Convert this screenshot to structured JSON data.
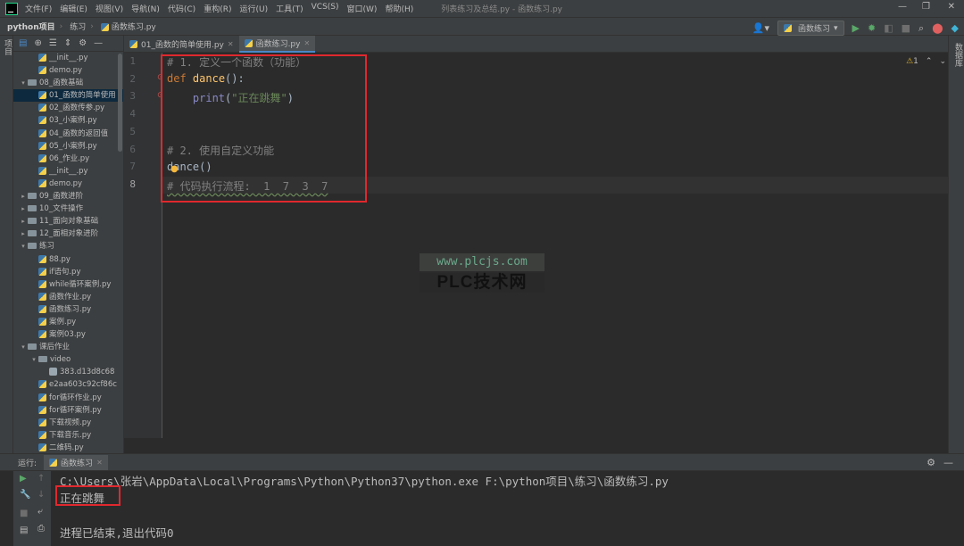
{
  "menubar": {
    "items": [
      "文件(F)",
      "编辑(E)",
      "视图(V)",
      "导航(N)",
      "代码(C)",
      "重构(R)",
      "运行(U)",
      "工具(T)",
      "VCS(S)",
      "窗口(W)",
      "帮助(H)"
    ],
    "window_title": "列表练习及总结.py - 函数练习.py"
  },
  "navbar": {
    "project": "python项目",
    "folder": "练习",
    "file": "函数练习.py",
    "run_config": "函数练习"
  },
  "left_strip": {
    "project_label": "项目"
  },
  "right_strip": {
    "label": "数据库"
  },
  "tree": [
    {
      "label": "__init__.py",
      "indent": 3,
      "type": "file"
    },
    {
      "label": "demo.py",
      "indent": 3,
      "type": "file"
    },
    {
      "label": "08_函数基础",
      "indent": 2,
      "type": "folder",
      "arrow": "▾"
    },
    {
      "label": "01_函数的简单使用",
      "indent": 3,
      "type": "file",
      "selected": true
    },
    {
      "label": "02_函数传参.py",
      "indent": 3,
      "type": "file"
    },
    {
      "label": "03_小案例.py",
      "indent": 3,
      "type": "file"
    },
    {
      "label": "04_函数的返回值",
      "indent": 3,
      "type": "file"
    },
    {
      "label": "05_小案例.py",
      "indent": 3,
      "type": "file"
    },
    {
      "label": "06_作业.py",
      "indent": 3,
      "type": "file"
    },
    {
      "label": "__init__.py",
      "indent": 3,
      "type": "file"
    },
    {
      "label": "demo.py",
      "indent": 3,
      "type": "file"
    },
    {
      "label": "09_函数进阶",
      "indent": 2,
      "type": "folder",
      "arrow": "▸"
    },
    {
      "label": "10_文件操作",
      "indent": 2,
      "type": "folder",
      "arrow": "▸"
    },
    {
      "label": "11_面向对象基础",
      "indent": 2,
      "type": "folder",
      "arrow": "▸"
    },
    {
      "label": "12_面相对象进阶",
      "indent": 2,
      "type": "folder",
      "arrow": "▸"
    },
    {
      "label": "练习",
      "indent": 2,
      "type": "folder",
      "arrow": "▾"
    },
    {
      "label": "88.py",
      "indent": 3,
      "type": "file"
    },
    {
      "label": "if语句.py",
      "indent": 3,
      "type": "file"
    },
    {
      "label": "while循环案例.py",
      "indent": 3,
      "type": "file"
    },
    {
      "label": "函数作业.py",
      "indent": 3,
      "type": "file"
    },
    {
      "label": "函数练习.py",
      "indent": 3,
      "type": "file"
    },
    {
      "label": "案例.py",
      "indent": 3,
      "type": "file"
    },
    {
      "label": "案例03.py",
      "indent": 3,
      "type": "file"
    },
    {
      "label": "课后作业",
      "indent": 2,
      "type": "folder",
      "arrow": "▾"
    },
    {
      "label": "video",
      "indent": 3,
      "type": "folder",
      "arrow": "▾"
    },
    {
      "label": "383.d13d8c68",
      "indent": 4,
      "type": "plain"
    },
    {
      "label": "e2aa603c92cf86c",
      "indent": 3,
      "type": "file"
    },
    {
      "label": "for循环作业.py",
      "indent": 3,
      "type": "file"
    },
    {
      "label": "for循环案例.py",
      "indent": 3,
      "type": "file"
    },
    {
      "label": "下载视频.py",
      "indent": 3,
      "type": "file"
    },
    {
      "label": "下载音乐.py",
      "indent": 3,
      "type": "file"
    },
    {
      "label": "二维码.py",
      "indent": 3,
      "type": "file"
    }
  ],
  "tabs": [
    {
      "label": "01_函数的简单使用.py",
      "active": false
    },
    {
      "label": "函数练习.py",
      "active": true
    }
  ],
  "editor": {
    "line_numbers": [
      "1",
      "2",
      "3",
      "4",
      "5",
      "6",
      "7",
      "8"
    ],
    "current_line": "8",
    "inspection_count": "1",
    "line1": "# 1. 定义一个函数（功能）",
    "line2_kw": "def",
    "line2_fn": "dance",
    "line2_rest": "():",
    "line3_builtin": "print",
    "line3_str": "\"正在跳舞\"",
    "line6": "# 2. 使用自定义功能",
    "line7": "dance()",
    "line8": "# 代码执行流程:  1  7  3  7"
  },
  "watermark": {
    "url": "www.plcjs.com",
    "name": "PLC技术网"
  },
  "run": {
    "label": "运行:",
    "tab": "函数练习",
    "command": "C:\\Users\\张岩\\AppData\\Local\\Programs\\Python\\Python37\\python.exe F:\\python项目\\练习\\函数练习.py",
    "output": "正在跳舞",
    "exit": "进程已结束,退出代码0"
  }
}
